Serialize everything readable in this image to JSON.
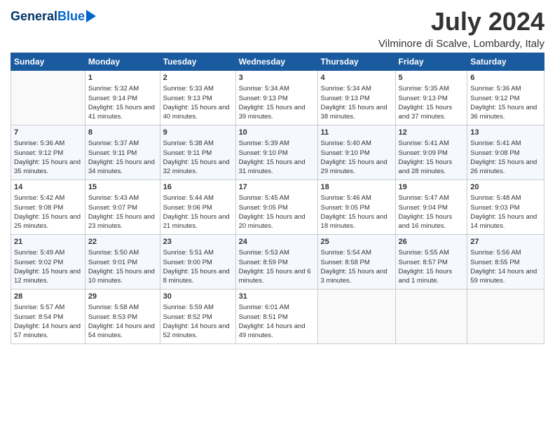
{
  "header": {
    "logo_line1": "General",
    "logo_line2": "Blue",
    "month_year": "July 2024",
    "location": "Vilminore di Scalve, Lombardy, Italy"
  },
  "weekdays": [
    "Sunday",
    "Monday",
    "Tuesday",
    "Wednesday",
    "Thursday",
    "Friday",
    "Saturday"
  ],
  "weeks": [
    [
      {
        "day": "",
        "sunrise": "",
        "sunset": "",
        "daylight": ""
      },
      {
        "day": "1",
        "sunrise": "Sunrise: 5:32 AM",
        "sunset": "Sunset: 9:14 PM",
        "daylight": "Daylight: 15 hours and 41 minutes."
      },
      {
        "day": "2",
        "sunrise": "Sunrise: 5:33 AM",
        "sunset": "Sunset: 9:13 PM",
        "daylight": "Daylight: 15 hours and 40 minutes."
      },
      {
        "day": "3",
        "sunrise": "Sunrise: 5:34 AM",
        "sunset": "Sunset: 9:13 PM",
        "daylight": "Daylight: 15 hours and 39 minutes."
      },
      {
        "day": "4",
        "sunrise": "Sunrise: 5:34 AM",
        "sunset": "Sunset: 9:13 PM",
        "daylight": "Daylight: 15 hours and 38 minutes."
      },
      {
        "day": "5",
        "sunrise": "Sunrise: 5:35 AM",
        "sunset": "Sunset: 9:13 PM",
        "daylight": "Daylight: 15 hours and 37 minutes."
      },
      {
        "day": "6",
        "sunrise": "Sunrise: 5:36 AM",
        "sunset": "Sunset: 9:12 PM",
        "daylight": "Daylight: 15 hours and 36 minutes."
      }
    ],
    [
      {
        "day": "7",
        "sunrise": "Sunrise: 5:36 AM",
        "sunset": "Sunset: 9:12 PM",
        "daylight": "Daylight: 15 hours and 35 minutes."
      },
      {
        "day": "8",
        "sunrise": "Sunrise: 5:37 AM",
        "sunset": "Sunset: 9:11 PM",
        "daylight": "Daylight: 15 hours and 34 minutes."
      },
      {
        "day": "9",
        "sunrise": "Sunrise: 5:38 AM",
        "sunset": "Sunset: 9:11 PM",
        "daylight": "Daylight: 15 hours and 32 minutes."
      },
      {
        "day": "10",
        "sunrise": "Sunrise: 5:39 AM",
        "sunset": "Sunset: 9:10 PM",
        "daylight": "Daylight: 15 hours and 31 minutes."
      },
      {
        "day": "11",
        "sunrise": "Sunrise: 5:40 AM",
        "sunset": "Sunset: 9:10 PM",
        "daylight": "Daylight: 15 hours and 29 minutes."
      },
      {
        "day": "12",
        "sunrise": "Sunrise: 5:41 AM",
        "sunset": "Sunset: 9:09 PM",
        "daylight": "Daylight: 15 hours and 28 minutes."
      },
      {
        "day": "13",
        "sunrise": "Sunrise: 5:41 AM",
        "sunset": "Sunset: 9:08 PM",
        "daylight": "Daylight: 15 hours and 26 minutes."
      }
    ],
    [
      {
        "day": "14",
        "sunrise": "Sunrise: 5:42 AM",
        "sunset": "Sunset: 9:08 PM",
        "daylight": "Daylight: 15 hours and 25 minutes."
      },
      {
        "day": "15",
        "sunrise": "Sunrise: 5:43 AM",
        "sunset": "Sunset: 9:07 PM",
        "daylight": "Daylight: 15 hours and 23 minutes."
      },
      {
        "day": "16",
        "sunrise": "Sunrise: 5:44 AM",
        "sunset": "Sunset: 9:06 PM",
        "daylight": "Daylight: 15 hours and 21 minutes."
      },
      {
        "day": "17",
        "sunrise": "Sunrise: 5:45 AM",
        "sunset": "Sunset: 9:05 PM",
        "daylight": "Daylight: 15 hours and 20 minutes."
      },
      {
        "day": "18",
        "sunrise": "Sunrise: 5:46 AM",
        "sunset": "Sunset: 9:05 PM",
        "daylight": "Daylight: 15 hours and 18 minutes."
      },
      {
        "day": "19",
        "sunrise": "Sunrise: 5:47 AM",
        "sunset": "Sunset: 9:04 PM",
        "daylight": "Daylight: 15 hours and 16 minutes."
      },
      {
        "day": "20",
        "sunrise": "Sunrise: 5:48 AM",
        "sunset": "Sunset: 9:03 PM",
        "daylight": "Daylight: 15 hours and 14 minutes."
      }
    ],
    [
      {
        "day": "21",
        "sunrise": "Sunrise: 5:49 AM",
        "sunset": "Sunset: 9:02 PM",
        "daylight": "Daylight: 15 hours and 12 minutes."
      },
      {
        "day": "22",
        "sunrise": "Sunrise: 5:50 AM",
        "sunset": "Sunset: 9:01 PM",
        "daylight": "Daylight: 15 hours and 10 minutes."
      },
      {
        "day": "23",
        "sunrise": "Sunrise: 5:51 AM",
        "sunset": "Sunset: 9:00 PM",
        "daylight": "Daylight: 15 hours and 8 minutes."
      },
      {
        "day": "24",
        "sunrise": "Sunrise: 5:53 AM",
        "sunset": "Sunset: 8:59 PM",
        "daylight": "Daylight: 15 hours and 6 minutes."
      },
      {
        "day": "25",
        "sunrise": "Sunrise: 5:54 AM",
        "sunset": "Sunset: 8:58 PM",
        "daylight": "Daylight: 15 hours and 3 minutes."
      },
      {
        "day": "26",
        "sunrise": "Sunrise: 5:55 AM",
        "sunset": "Sunset: 8:57 PM",
        "daylight": "Daylight: 15 hours and 1 minute."
      },
      {
        "day": "27",
        "sunrise": "Sunrise: 5:56 AM",
        "sunset": "Sunset: 8:55 PM",
        "daylight": "Daylight: 14 hours and 59 minutes."
      }
    ],
    [
      {
        "day": "28",
        "sunrise": "Sunrise: 5:57 AM",
        "sunset": "Sunset: 8:54 PM",
        "daylight": "Daylight: 14 hours and 57 minutes."
      },
      {
        "day": "29",
        "sunrise": "Sunrise: 5:58 AM",
        "sunset": "Sunset: 8:53 PM",
        "daylight": "Daylight: 14 hours and 54 minutes."
      },
      {
        "day": "30",
        "sunrise": "Sunrise: 5:59 AM",
        "sunset": "Sunset: 8:52 PM",
        "daylight": "Daylight: 14 hours and 52 minutes."
      },
      {
        "day": "31",
        "sunrise": "Sunrise: 6:01 AM",
        "sunset": "Sunset: 8:51 PM",
        "daylight": "Daylight: 14 hours and 49 minutes."
      },
      {
        "day": "",
        "sunrise": "",
        "sunset": "",
        "daylight": ""
      },
      {
        "day": "",
        "sunrise": "",
        "sunset": "",
        "daylight": ""
      },
      {
        "day": "",
        "sunrise": "",
        "sunset": "",
        "daylight": ""
      }
    ]
  ]
}
